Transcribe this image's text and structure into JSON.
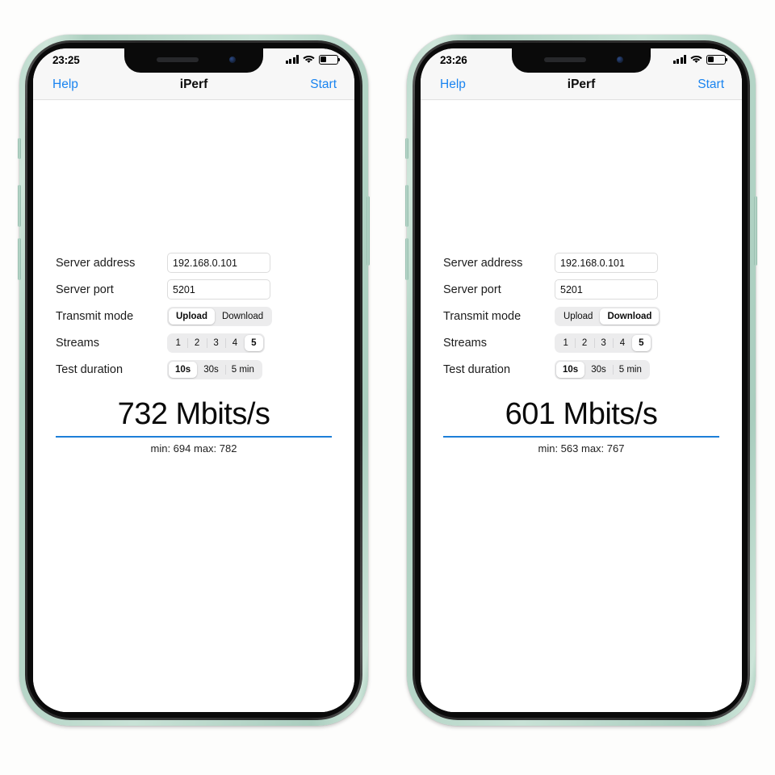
{
  "background_color": "#fdfdfc",
  "accent_blue": "#1a84f0",
  "rule_blue": "#1d7fd8",
  "frame_color": "#c8e2d6",
  "phones": [
    {
      "side": "left",
      "status": {
        "time": "23:25",
        "cellular_bars_active": 4,
        "cellular_bars_total": 4,
        "wifi_icon": "wifi-icon",
        "battery_icon": "battery-icon",
        "battery_percent": 35
      },
      "nav": {
        "help_label": "Help",
        "title": "iPerf",
        "start_label": "Start"
      },
      "form": {
        "server_address": {
          "label": "Server address",
          "value": "192.168.0.101",
          "placeholder": "Server address"
        },
        "server_port": {
          "label": "Server port",
          "value": "5201",
          "placeholder": "Server port"
        },
        "transmit_mode": {
          "label": "Transmit mode",
          "options": [
            "Upload",
            "Download"
          ],
          "selected": "Upload"
        },
        "streams": {
          "label": "Streams",
          "options": [
            "1",
            "2",
            "3",
            "4",
            "5"
          ],
          "selected": "5"
        },
        "test_duration": {
          "label": "Test duration",
          "options": [
            "10s",
            "30s",
            "5 min"
          ],
          "selected": "10s"
        }
      },
      "result": {
        "value": "732 Mbits/s",
        "throughput": 732,
        "unit": "Mbits/s",
        "min": 694,
        "max": 782,
        "minmax_text": "min: 694 max: 782"
      }
    },
    {
      "side": "right",
      "status": {
        "time": "23:26",
        "cellular_bars_active": 4,
        "cellular_bars_total": 4,
        "wifi_icon": "wifi-icon",
        "battery_icon": "battery-icon",
        "battery_percent": 35
      },
      "nav": {
        "help_label": "Help",
        "title": "iPerf",
        "start_label": "Start"
      },
      "form": {
        "server_address": {
          "label": "Server address",
          "value": "192.168.0.101",
          "placeholder": "Server address"
        },
        "server_port": {
          "label": "Server port",
          "value": "5201",
          "placeholder": "Server port"
        },
        "transmit_mode": {
          "label": "Transmit mode",
          "options": [
            "Upload",
            "Download"
          ],
          "selected": "Download"
        },
        "streams": {
          "label": "Streams",
          "options": [
            "1",
            "2",
            "3",
            "4",
            "5"
          ],
          "selected": "5"
        },
        "test_duration": {
          "label": "Test duration",
          "options": [
            "10s",
            "30s",
            "5 min"
          ],
          "selected": "10s"
        }
      },
      "result": {
        "value": "601 Mbits/s",
        "throughput": 601,
        "unit": "Mbits/s",
        "min": 563,
        "max": 767,
        "minmax_text": "min: 563 max: 767"
      }
    }
  ]
}
